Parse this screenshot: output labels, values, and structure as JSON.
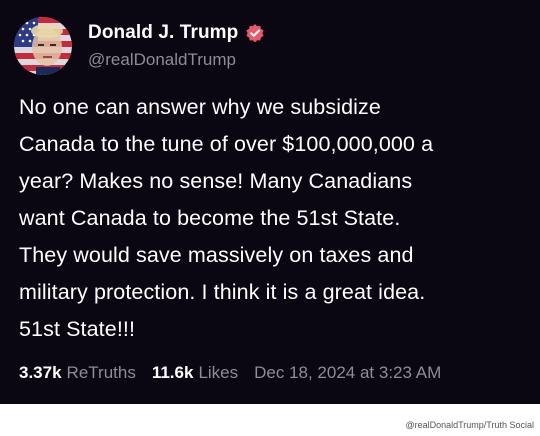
{
  "author": {
    "display_name": "Donald J. Trump",
    "handle": "@realDonaldTrump",
    "verified_badge_icon": "verified-check-icon",
    "verified_color": "#e85a6a"
  },
  "post": {
    "text": "No one can answer why we subsidize\nCanada to the tune of over $100,000,000 a\nyear? Makes no sense! Many Canadians\nwant Canada to become the 51st State.\nThey would save massively on taxes and\nmilitary protection. I think it is a great idea.\n51st State!!!"
  },
  "stats": {
    "retruths_count": "3.37k",
    "retruths_label": "ReTruths",
    "likes_count": "11.6k",
    "likes_label": "Likes",
    "timestamp": "Dec 18, 2024 at 3:23 AM"
  },
  "credit": "@realDonaldTrump/Truth Social",
  "colors": {
    "card_background": "#0a0612",
    "text_primary": "#ffffff",
    "text_secondary": "#8e8c96"
  }
}
